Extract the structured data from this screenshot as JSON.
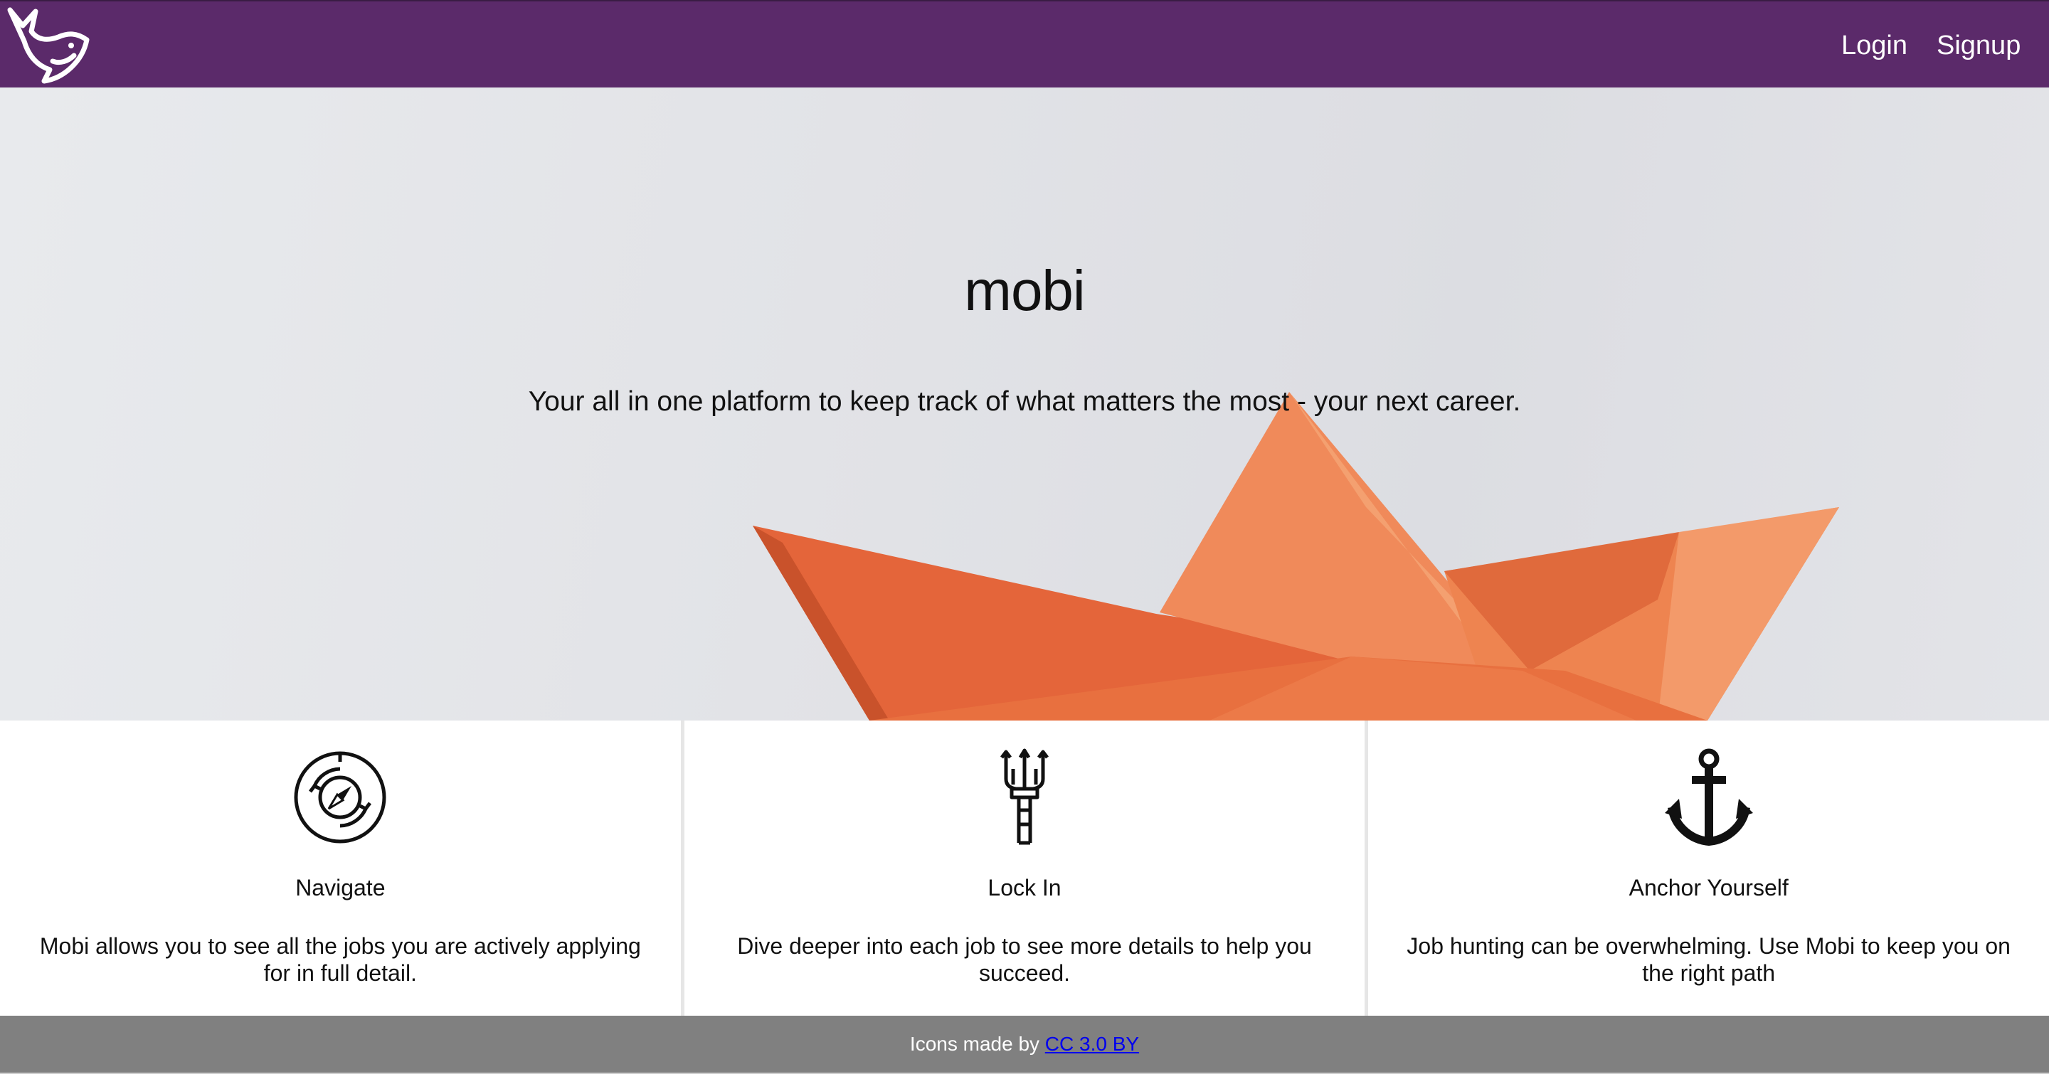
{
  "header": {
    "logo_icon": "whale-icon",
    "login_label": "Login",
    "signup_label": "Signup",
    "background_color": "#5b2a6a"
  },
  "hero": {
    "title": "mobi",
    "tagline": "Your all in one platform to keep track of what matters the most - your next career.",
    "image": "orange-paper-boat",
    "accent_color": "#e8703f"
  },
  "features": [
    {
      "icon": "compass-icon",
      "title": "Navigate",
      "text": "Mobi allows you to see all the jobs you are actively applying for in full detail."
    },
    {
      "icon": "trident-icon",
      "title": "Lock In",
      "text": "Dive deeper into each job to see more details to help you succeed."
    },
    {
      "icon": "anchor-icon",
      "title": "Anchor Yourself",
      "text": "Job hunting can be overwhelming. Use Mobi to keep you on the right path"
    }
  ],
  "footer": {
    "prefix": "Icons made by ",
    "link_text": "CC 3.0 BY",
    "background_color": "#808080"
  }
}
